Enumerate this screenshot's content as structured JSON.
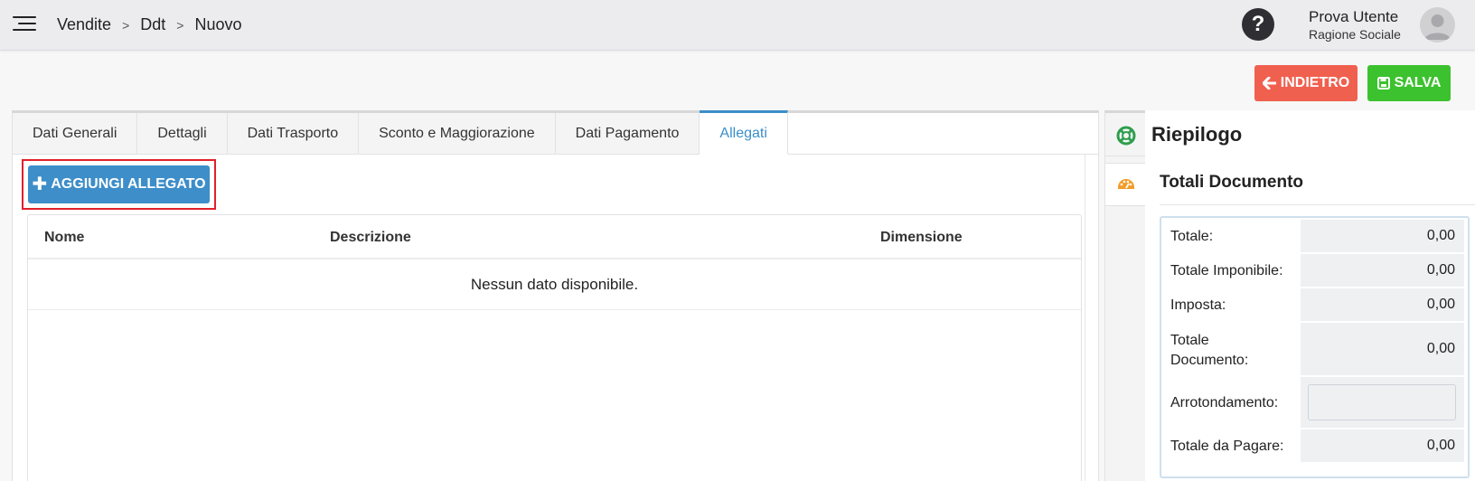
{
  "header": {
    "breadcrumb": [
      "Vendite",
      "Ddt",
      "Nuovo"
    ],
    "user": {
      "name": "Prova Utente",
      "organization": "Ragione Sociale"
    },
    "icons": {
      "menu": "hamburger-icon",
      "help": "question-icon",
      "avatar": "user-avatar-icon"
    }
  },
  "actions": {
    "back_label": "INDIETRO",
    "save_label": "SALVA",
    "back_color": "#f0604f",
    "save_color": "#3cc22f"
  },
  "tabs": [
    {
      "label": "Dati Generali",
      "active": false
    },
    {
      "label": "Dettagli",
      "active": false
    },
    {
      "label": "Dati Trasporto",
      "active": false
    },
    {
      "label": "Sconto e Maggiorazione",
      "active": false
    },
    {
      "label": "Dati Pagamento",
      "active": false
    },
    {
      "label": "Allegati",
      "active": true
    }
  ],
  "attachments": {
    "add_button_label": "AGGIUNGI ALLEGATO",
    "columns": [
      "Nome",
      "Descrizione",
      "Dimensione"
    ],
    "empty_message": "Nessun dato disponibile.",
    "rows": []
  },
  "summary": {
    "title": "Riepilogo",
    "section_title": "Totali Documento",
    "rows": [
      {
        "label": "Totale:",
        "value": "0,00"
      },
      {
        "label": "Totale Imponibile:",
        "value": "0,00"
      },
      {
        "label": "Imposta:",
        "value": "0,00"
      },
      {
        "label": "Totale Documento:",
        "value": "0,00"
      },
      {
        "label": "Arrotondamento:",
        "value": ""
      },
      {
        "label": "Totale da Pagare:",
        "value": "0,00"
      }
    ],
    "side_icons": [
      "lifebuoy-icon",
      "palette-icon"
    ]
  },
  "colors": {
    "accent": "#3b8ec8",
    "highlight": "#e0212a"
  }
}
